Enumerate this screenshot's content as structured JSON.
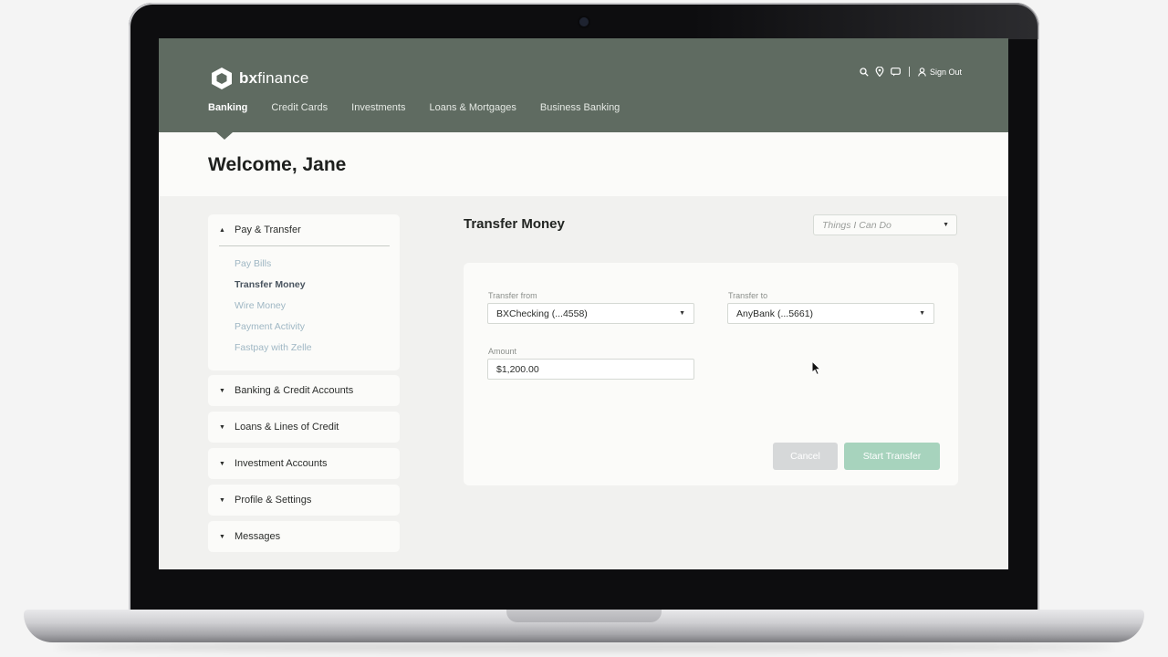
{
  "brand": {
    "name_bold": "bx",
    "name_light": "finance"
  },
  "header": {
    "icons": [
      "search-icon",
      "location-pin-icon",
      "chat-icon",
      "user-icon"
    ],
    "sign_out": "Sign Out",
    "nav": [
      "Banking",
      "Credit Cards",
      "Investments",
      "Loans & Mortgages",
      "Business Banking"
    ],
    "active_nav": "Banking"
  },
  "welcome": "Welcome, Jane",
  "sidebar": {
    "expanded": {
      "label": "Pay & Transfer",
      "items": [
        "Pay Bills",
        "Transfer Money",
        "Wire Money",
        "Payment Activity",
        "Fastpay with Zelle"
      ],
      "current": "Transfer Money"
    },
    "collapsed": [
      "Banking & Credit Accounts",
      "Loans & Lines of Credit",
      "Investment Accounts",
      "Profile & Settings",
      "Messages"
    ]
  },
  "main": {
    "title": "Transfer Money",
    "things_placeholder": "Things I Can Do",
    "form": {
      "from_label": "Transfer from",
      "from_value": "BXChecking (...4558)",
      "to_label": "Transfer to",
      "to_value": "AnyBank (...5661)",
      "amount_label": "Amount",
      "amount_value": "$1,200.00",
      "cancel": "Cancel",
      "start": "Start Transfer"
    }
  },
  "colors": {
    "header_bg": "#5f6b61",
    "link": "#9fb7c4",
    "start_button": "#a7d3bd",
    "cancel_button": "#d6d8d9"
  }
}
